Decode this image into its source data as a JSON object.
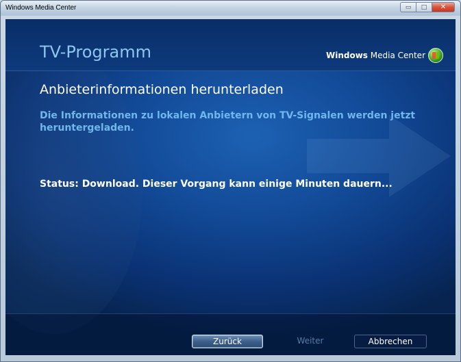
{
  "window": {
    "title": "Windows Media Center",
    "controls": {
      "minimize": "▭",
      "maximize": "□",
      "close": "✕"
    }
  },
  "header": {
    "title": "TV-Programm",
    "brand": {
      "bold": "Windows",
      "rest": " Media Center",
      "logo_icon": "windows-flag-icon"
    }
  },
  "content": {
    "heading": "Anbieterinformationen herunterladen",
    "description": "Die Informationen zu lokalen Anbietern von TV-Signalen werden jetzt heruntergeladen.",
    "status": "Status: Download. Dieser Vorgang kann einige Minuten dauern..."
  },
  "footer": {
    "back_label": "Zurück",
    "next_label": "Weiter",
    "cancel_label": "Abbrechen"
  },
  "colors": {
    "background": "#0d3a7d",
    "title_text": "#8ec6ee",
    "description_text": "#6fb7ec",
    "disabled_text": "#567ca8"
  }
}
